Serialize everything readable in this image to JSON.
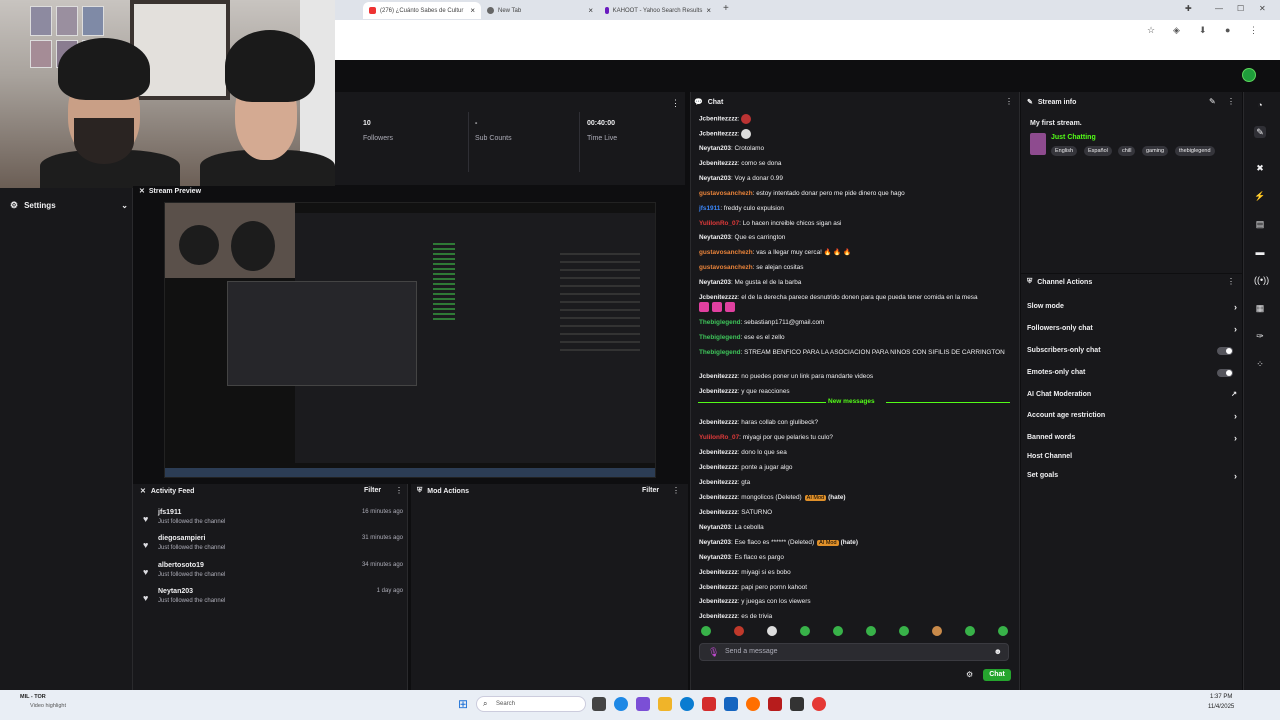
{
  "browser": {
    "tabs": [
      {
        "title": "(276) ¿Cuánto Sabes de Cultur",
        "color": "#e33"
      },
      {
        "title": "New Tab",
        "color": "#666"
      },
      {
        "title": "KAHOOT - Yahoo Search Results",
        "color": "#6a1bbf"
      }
    ],
    "new_tab": "+"
  },
  "stats": [
    {
      "value": "10",
      "label": "Followers"
    },
    {
      "value": "-",
      "label": "Sub Counts"
    },
    {
      "value": "00:40:00",
      "label": "Time Live"
    }
  ],
  "settings": {
    "label": "Settings"
  },
  "preview": {
    "title": "Stream Preview"
  },
  "activity": {
    "title": "Activity Feed",
    "filter": "Filter",
    "items": [
      {
        "name": "jfs1911",
        "desc": "Just followed the channel",
        "time": "16 minutes ago"
      },
      {
        "name": "diegosampieri",
        "desc": "Just followed the channel",
        "time": "31 minutes ago"
      },
      {
        "name": "albertosoto19",
        "desc": "Just followed the channel",
        "time": "34 minutes ago"
      },
      {
        "name": "Neytan203",
        "desc": "Just followed the channel",
        "time": "1 day ago"
      }
    ]
  },
  "mod": {
    "title": "Mod Actions",
    "filter": "Filter"
  },
  "chat": {
    "title": "Chat",
    "new_messages": "New messages",
    "input_placeholder": "Send a message",
    "send": "Chat",
    "messages": [
      {
        "user": "Jcbenitezzzz",
        "color": "#efeff1",
        "text": ""
      },
      {
        "user": "Jcbenitezzzz",
        "color": "#efeff1",
        "text": ""
      },
      {
        "user": "Neytan203",
        "color": "#efeff1",
        "text": "Crotolamo"
      },
      {
        "user": "Jcbenitezzzz",
        "color": "#efeff1",
        "text": "como se dona"
      },
      {
        "user": "Neytan203",
        "color": "#efeff1",
        "text": "Voy a donar 0.99"
      },
      {
        "user": "gustavosanchezh",
        "color": "#e8833a",
        "text": "estoy intentado donar pero me pide dinero que hago"
      },
      {
        "user": "jfs1911",
        "color": "#3b86f7",
        "text": "freddy culo expulsion"
      },
      {
        "user": "YuliIonRo_07",
        "color": "#e03a3a",
        "text": "Lo hacen increible chicos sigan asi"
      },
      {
        "user": "Neytan203",
        "color": "#efeff1",
        "text": "Que es carrington"
      },
      {
        "user": "gustavosanchezh",
        "color": "#e8833a",
        "text": "vas a llegar muy cerca! 🔥 🔥 🔥"
      },
      {
        "user": "gustavosanchezh",
        "color": "#e8833a",
        "text": "se alejan cositas"
      },
      {
        "user": "Neytan203",
        "color": "#efeff1",
        "text": "Me gusta el de la barba"
      },
      {
        "user": "Jcbenitezzzz",
        "color": "#efeff1",
        "text": "el de la derecha parece desnutrido donen para que pueda tener comida en la mesa"
      },
      {
        "user": "Thebiglegend",
        "color": "#3ec45a",
        "text": "sebastianp1711@gmail.com"
      },
      {
        "user": "Thebiglegend",
        "color": "#3ec45a",
        "text": "ese es el zello"
      },
      {
        "user": "Thebiglegend",
        "color": "#3ec45a",
        "text": "STREAM BENFICO PARA LA ASOCIACION PARA NINOS CON SIFILIS DE CARRINGTON"
      },
      {
        "user": "Jcbenitezzzz",
        "color": "#efeff1",
        "text": "no puedes poner un link para mandarte videos"
      },
      {
        "user": "Jcbenitezzzz",
        "color": "#efeff1",
        "text": "y que reacciones"
      },
      {
        "user": "Jcbenitezzzz",
        "color": "#efeff1",
        "text": "haras collab con glulibeck?"
      },
      {
        "user": "YuliIonRo_07",
        "color": "#e03a3a",
        "text": "miyagi por que pelaries tu culo?"
      },
      {
        "user": "Jcbenitezzzz",
        "color": "#efeff1",
        "text": "dono lo que sea"
      },
      {
        "user": "Jcbenitezzzz",
        "color": "#efeff1",
        "text": "ponte a jugar algo"
      },
      {
        "user": "Jcbenitezzzz",
        "color": "#efeff1",
        "text": "gta"
      },
      {
        "user": "Jcbenitezzzz",
        "color": "#efeff1",
        "text": "mongolicos (Deleted)"
      },
      {
        "user": "Jcbenitezzzz",
        "color": "#efeff1",
        "text": "SATURNO"
      },
      {
        "user": "Neytan203",
        "color": "#efeff1",
        "text": "La cebolla"
      },
      {
        "user": "Neytan203",
        "color": "#efeff1",
        "text": "Ese flaco es ****** (Deleted)"
      },
      {
        "user": "Neytan203",
        "color": "#efeff1",
        "text": "Es flaco es pargo"
      },
      {
        "user": "Jcbenitezzzz",
        "color": "#efeff1",
        "text": "miyagi si es bobo"
      },
      {
        "user": "Jcbenitezzzz",
        "color": "#efeff1",
        "text": "papi pero pornn kahoot"
      },
      {
        "user": "Jcbenitezzzz",
        "color": "#efeff1",
        "text": "y juegas con los viewers"
      },
      {
        "user": "Jcbenitezzzz",
        "color": "#efeff1",
        "text": "es de trivia"
      }
    ],
    "ai_mod_label": "AI Mod",
    "hate_label": "(hate)"
  },
  "stream_info": {
    "title": "Stream info",
    "stream_title": "My first stream.",
    "category": "Just Chatting",
    "tags": [
      "English",
      "Español",
      "chill",
      "gaming",
      "thebiglegend"
    ]
  },
  "channel_actions": {
    "title": "Channel Actions",
    "items": [
      {
        "label": "Slow mode",
        "type": "arrow"
      },
      {
        "label": "Followers-only chat",
        "type": "arrow"
      },
      {
        "label": "Subscribers-only chat",
        "type": "toggle"
      },
      {
        "label": "Emotes-only chat",
        "type": "toggle"
      },
      {
        "label": "AI Chat Moderation",
        "type": "external"
      },
      {
        "label": "Account age restriction",
        "type": "arrow"
      },
      {
        "label": "Banned words",
        "type": "arrow"
      },
      {
        "label": "Host Channel",
        "type": "none"
      },
      {
        "label": "Set goals",
        "type": "arrow"
      }
    ]
  },
  "taskbar": {
    "search": "Search",
    "time": "1:37 PM",
    "date": "11/4/2025",
    "notify_title": "MIL - TOR",
    "notify_sub": "Video highlight"
  },
  "colors": {
    "accent": "#53fc18",
    "bg": "#18181b",
    "chat_button": "#25a52e"
  }
}
